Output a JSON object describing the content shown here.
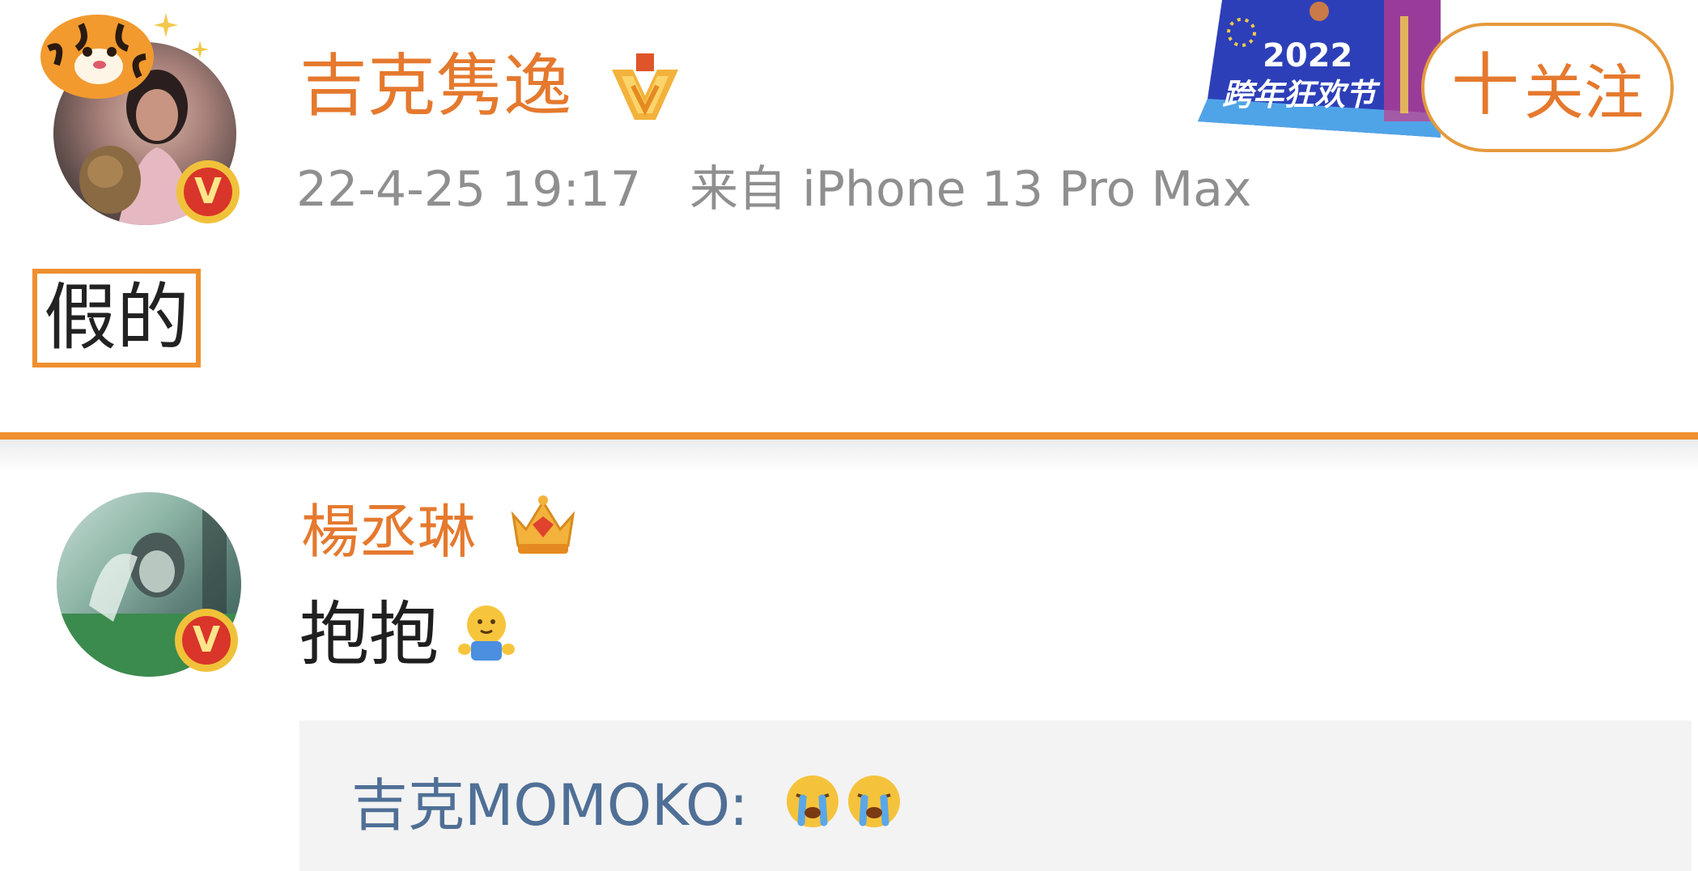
{
  "post": {
    "username": "吉克隽逸",
    "timestamp": "22-4-25 19:17",
    "source": "来自 iPhone 13 Pro Max",
    "text": "假的",
    "follow_button": "关注",
    "follow_plus": "十",
    "verified_badge": "V",
    "level_icon": "gold-v-medal-icon",
    "banner": {
      "year": "2022",
      "title": "跨年狂欢节"
    }
  },
  "comment": {
    "username": "楊丞琳",
    "verified_badge": "V",
    "level_icon": "crown-icon",
    "text": "抱抱",
    "emoji": "hug-emoji-icon",
    "quote": {
      "author": "吉克MOMOKO",
      "separator": ":",
      "emojis": [
        "crying-face-icon",
        "crying-face-icon"
      ]
    }
  },
  "colors": {
    "accent": "#E5792E",
    "highlight_border": "#EF8F2E",
    "meta_gray": "#8F8F8F",
    "quote_blue": "#4F6F96",
    "quote_bg": "#F3F3F3"
  }
}
